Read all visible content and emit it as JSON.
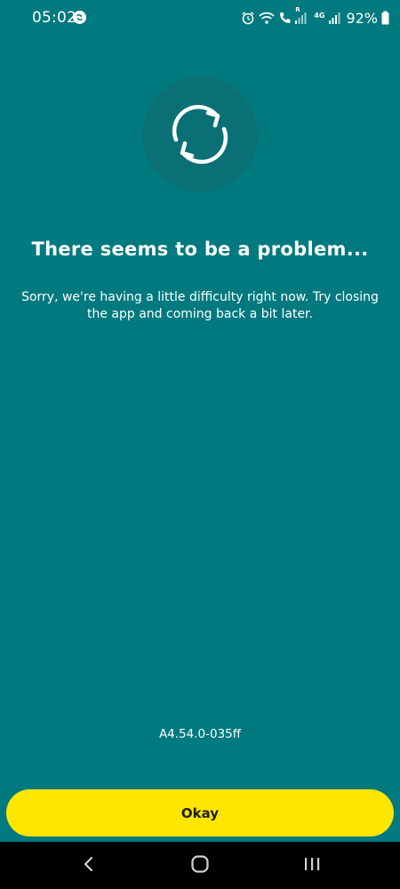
{
  "status_bar": {
    "time": "05:02",
    "battery": "92%",
    "network_label": "4G",
    "roaming_label": "R",
    "icons": [
      "shazam-icon",
      "alarm-icon",
      "wifi-icon",
      "wifi-call-icon",
      "signal-icon",
      "signal-icon",
      "battery-icon"
    ]
  },
  "main": {
    "icon": "refresh-icon",
    "title": "There seems to be a problem...",
    "message": "Sorry, we're having a little difficulty right now. Try closing the app and coming back a bit later.",
    "version": "A4.54.0-035ff"
  },
  "footer": {
    "button_label": "Okay"
  },
  "nav_bar": {
    "icons": [
      "back-icon",
      "home-icon",
      "recent-apps-icon"
    ]
  },
  "colors": {
    "background": "#00797f",
    "accent_button": "#ffe600",
    "text": "#ffffff",
    "button_text": "#1e1e1e"
  }
}
